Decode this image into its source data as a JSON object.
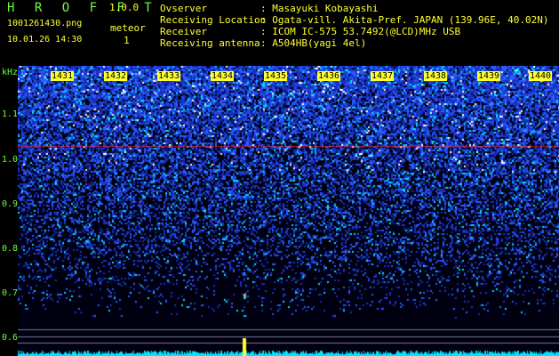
{
  "header": {
    "app_title": "H R O F F T",
    "version": "1.0.0",
    "file_name": "1001261430.png",
    "detect_label": "meteor",
    "datetime": "10.01.26 14:30",
    "detect_count": "1",
    "info_rows": [
      {
        "label": "Ovserver",
        "value": ": Masayuki Kobayashi"
      },
      {
        "label": "Receiving Location",
        "value": ": Ogata-vill. Akita-Pref. JAPAN (139.96E, 40.02N)"
      },
      {
        "label": "Receiver",
        "value": ": ICOM IC-575 53.7492(@LCD)MHz USB"
      },
      {
        "label": "Receiving antenna",
        "value": ": A504HB(yagi 4el)"
      }
    ]
  },
  "axis": {
    "y_unit": "kHz",
    "y_ticks": [
      "1.1",
      "1.0",
      "0.9",
      "0.8",
      "0.7",
      "0.6"
    ],
    "x_ticks": [
      "1431",
      "1432",
      "1433",
      "1434",
      "1435",
      "1436",
      "1437",
      "1438",
      "1439",
      "1440"
    ]
  },
  "colors": {
    "label_green": "#6cff3a",
    "label_yellow": "#ffff33",
    "band_blue": "#1a3cff",
    "trace_cyan": "#00e5ff",
    "marker_red": "#ff3030"
  }
}
